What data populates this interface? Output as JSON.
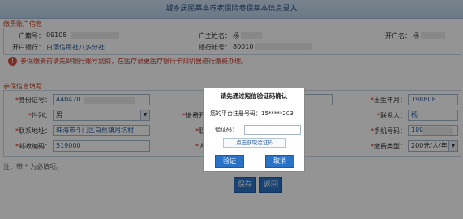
{
  "window": {
    "title": "城乡居民基本养老保险参保基本信息录入"
  },
  "account_section": {
    "heading": "缴费账户信息",
    "household_no_label": "户籍号：",
    "household_no_value": "09108",
    "head_name_label": "户主姓名：",
    "head_name_value": "杨",
    "account_name_label": "开户名：",
    "account_name_value": "杨",
    "bank_label": "开户银行：",
    "bank_value": "白蒲信用社八多分社",
    "account_no_label": "银行帐号：",
    "account_no_value": "80010"
  },
  "warning": {
    "text": "参保缴费前请先到银行账号划扣，在医疗录更医疗银行卡归机器进行缴费办理。"
  },
  "insured_section": {
    "heading": "参保信息填写",
    "id_label": "身份证号：",
    "id_value": "440420",
    "birth_label": "出生年月：",
    "birth_value": "198808",
    "gender_label": "性别：",
    "gender_value": "男",
    "pay_label": "缴费开",
    "contact_label": "联系人：",
    "contact_value": "杨",
    "address_label": "联系地址：",
    "address_value": "珠海市斗门区白蕉镇月坑村",
    "link_label": "联",
    "mobile_label": "手机号码：",
    "mobile_value": "189",
    "postcode_label": "邮政编码：",
    "postcode_value": "519000",
    "person_label": "人",
    "pay_type_label": "缴费类型：",
    "pay_type_value": "200元/人/年",
    "note": "注：带 * 为必填项。"
  },
  "actions": {
    "save_label": "保存",
    "back_label": "返回"
  },
  "modal": {
    "title": "请先通过短信验证码确认",
    "phone_label": "您的平台注册号码：",
    "phone_value": "15*****203",
    "code_label": "验证码：",
    "code_value": "",
    "get_code_label": "点击获取验证码",
    "confirm_label": "验证",
    "cancel_label": "取消"
  },
  "colors": {
    "button_blue": "#2a72c6",
    "warning_red": "#c0392b",
    "title_blue": "#2b4f7c"
  }
}
